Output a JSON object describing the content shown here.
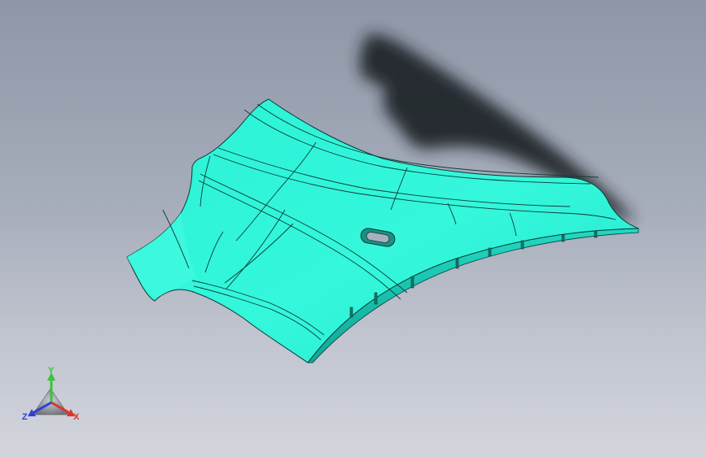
{
  "app": {
    "view": "3D part view"
  },
  "part": {
    "name": "",
    "face_color": "#2ff5d8",
    "edge_color": "#0c3a35",
    "shadow_color": "#1f2227"
  },
  "triad": {
    "x_label": "X",
    "y_label": "Y",
    "z_label": "Z",
    "x_color": "#e0342b",
    "y_color": "#39c43a",
    "z_color": "#2f3fd8"
  }
}
